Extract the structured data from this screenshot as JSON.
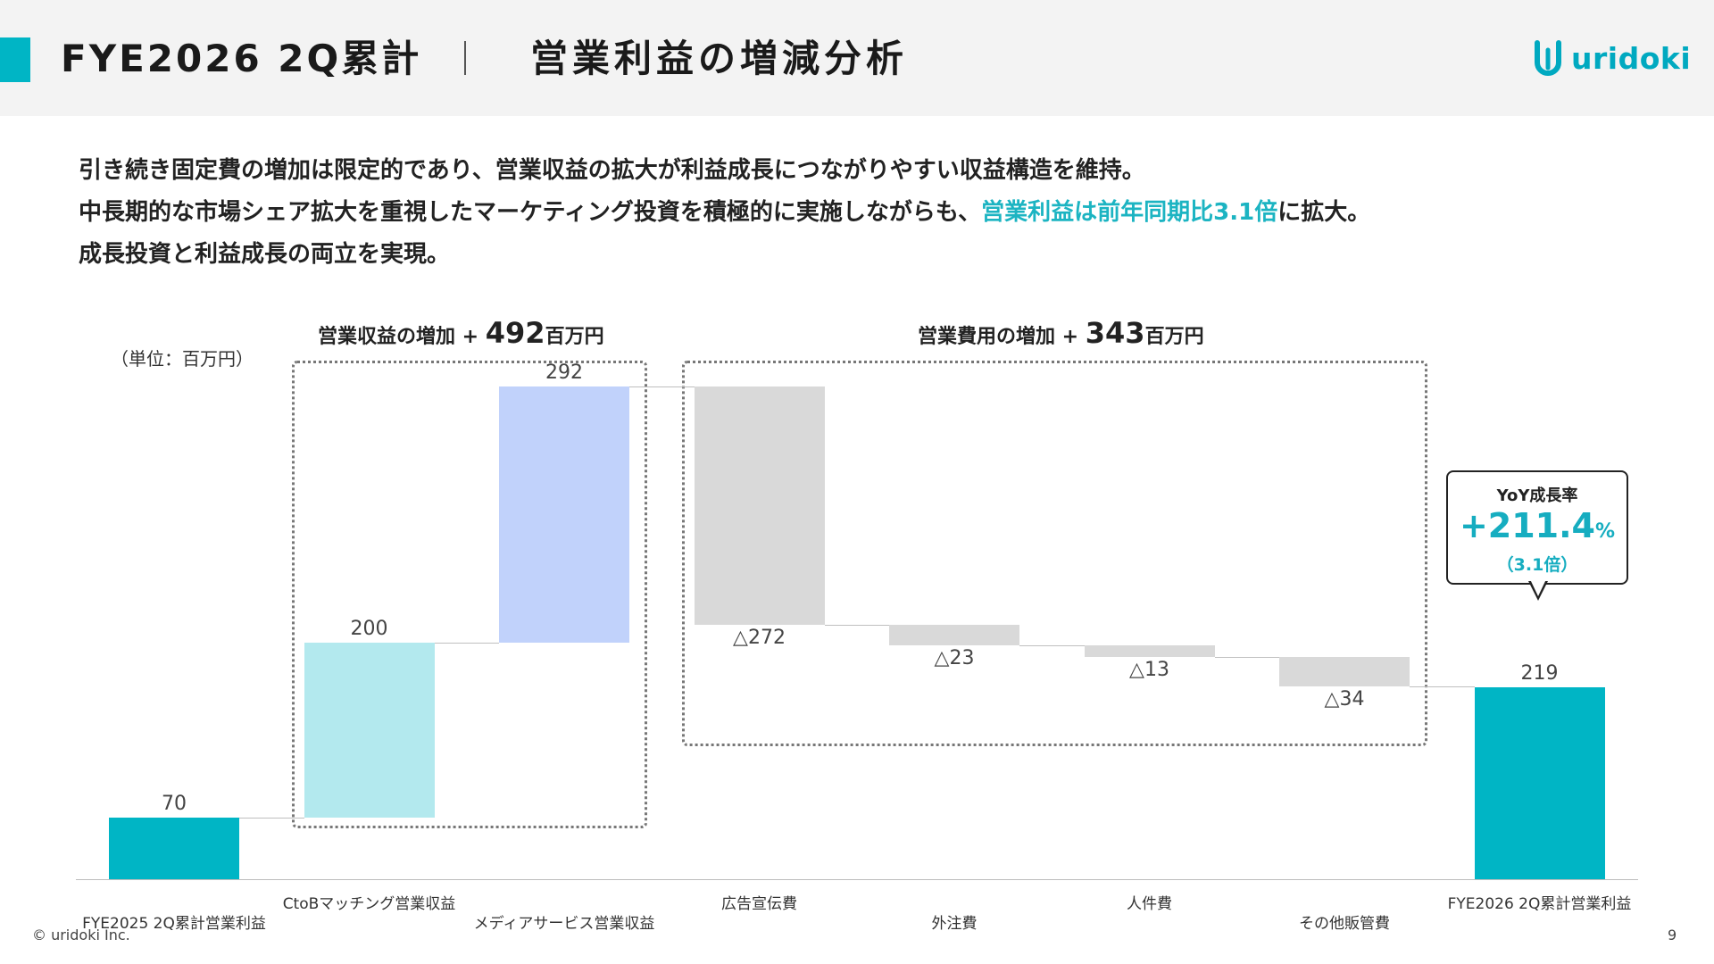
{
  "header": {
    "title": "FYE2026 2Q累計",
    "subtitle": "営業利益の増減分析",
    "logo_text": "uridoki",
    "accent_color": "#00b5c5"
  },
  "lead": {
    "line1": "引き続き固定費の増加は限定的であり、営業収益の拡大が利益成長につながりやすい収益構造を維持。",
    "line2_pre": "中長期的な市場シェア拡大を重視したマーケティング投資を積極的に実施しながらも、",
    "line2_highlight": "営業利益は前年同期比3.1倍",
    "line2_post": "に拡大。",
    "line3": "成長投資と利益成長の両立を実現。",
    "highlight_color": "#1cb4c2"
  },
  "chart_data": {
    "type": "waterfall",
    "unit_label": "（単位：百万円）",
    "categories": [
      "FYE2025 2Q累計営業利益",
      "CtoBマッチング営業収益",
      "メディアサービス営業収益",
      "広告宣伝費",
      "外注費",
      "人件費",
      "その他販管費",
      "FYE2026 2Q累計営業利益"
    ],
    "values": [
      70,
      200,
      292,
      -272,
      -23,
      -13,
      -34,
      219
    ],
    "kinds": [
      "total",
      "increase",
      "increase",
      "decrease",
      "decrease",
      "decrease",
      "decrease",
      "total"
    ],
    "value_labels": [
      "70",
      "200",
      "292",
      "△272",
      "△23",
      "△13",
      "△34",
      "219"
    ],
    "colors": [
      "#00b5c5",
      "#b3e9ee",
      "#c1d2fb",
      "#d9d9d9",
      "#d9d9d9",
      "#d9d9d9",
      "#d9d9d9",
      "#00b5c5"
    ],
    "groups": [
      {
        "label": "営業収益の増加 + ",
        "amount": "492",
        "suffix": "百万円",
        "from": 1,
        "to": 2
      },
      {
        "label": "営業費用の増加 + ",
        "amount": "343",
        "suffix": "百万円",
        "from": 3,
        "to": 6
      }
    ],
    "ylim": [
      0,
      562
    ]
  },
  "callout": {
    "title": "YoY成長率",
    "value": "+211.4",
    "value_unit": "%",
    "multiple": "（3.1倍）"
  },
  "footer": {
    "copyright": "© uridoki Inc.",
    "page": "9"
  }
}
